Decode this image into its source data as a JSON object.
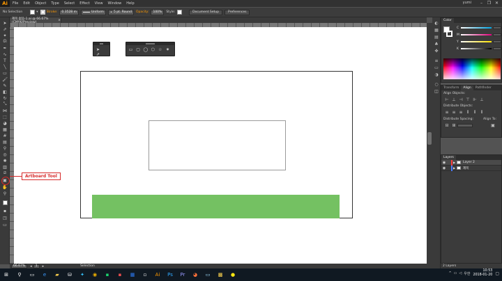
{
  "app": {
    "logo": "Ai"
  },
  "menu": [
    "File",
    "Edit",
    "Object",
    "Type",
    "Select",
    "Effect",
    "View",
    "Window",
    "Help"
  ],
  "workspace": "yumi",
  "window_controls": [
    "–",
    "❐",
    "✕"
  ],
  "control_bar": {
    "selection": "No Selection",
    "stroke_label": "Stroke:",
    "stroke_value": "0.3528 m",
    "uniform": "Uniform",
    "brush": "5 pt. Round",
    "opacity_label": "Opacity:",
    "opacity_value": "100%",
    "style_label": "Style:",
    "doc_setup": "Document Setup",
    "preferences": "Preferences"
  },
  "document_tab": "제목 없음-1.ai @ 66.67% (CMYK/Preview)",
  "callout": "Artboard Tool",
  "status": {
    "zoom": "66.67%",
    "page": "1",
    "mode": "Selection"
  },
  "panels": {
    "color_tab": "Color",
    "color_letters": [
      "C",
      "M",
      "Y",
      "K"
    ],
    "transform_tab": "Transform",
    "align_tab": "Align",
    "pathfinder_tab": "Pathfinder",
    "align_objects": "Align Objects:",
    "distribute_objects": "Distribute Objects:",
    "distribute_spacing": "Distribute Spacing:",
    "align_to": "Align To:",
    "layers_tab": "Layers",
    "layers": [
      {
        "name": "Layer 2",
        "color": "#ff3c3c"
      },
      {
        "name": "제목",
        "color": "#4a7bff"
      }
    ],
    "layers_count": "2 Layers"
  },
  "taskbar": {
    "ime": "우한",
    "time": "10:53",
    "date": "2018-01-20"
  },
  "colors": {
    "accent": "#ff9a00",
    "green_shape": "#74c162",
    "callout": "#d62a2a"
  }
}
